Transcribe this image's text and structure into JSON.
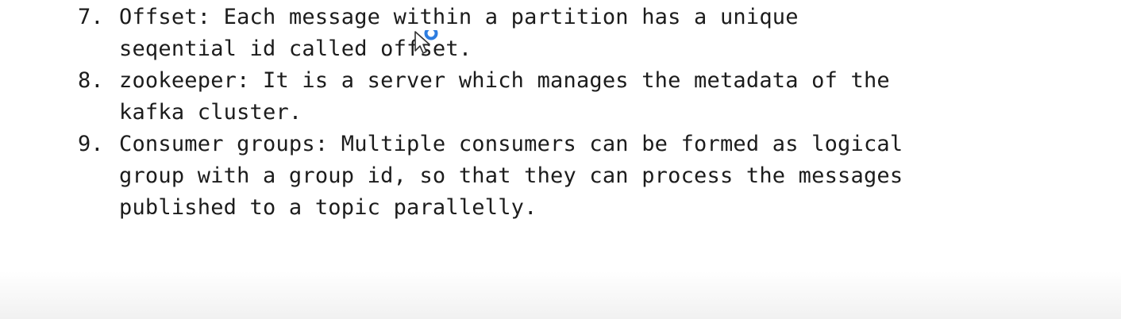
{
  "items": [
    {
      "number": "7.",
      "lines": [
        "Offset: Each message within a partition has a unique",
        "seqential id called offset."
      ]
    },
    {
      "number": "8.",
      "lines": [
        "zookeeper: It is a server which manages the metadata of the",
        "kafka cluster."
      ]
    },
    {
      "number": "9.",
      "lines": [
        "Consumer groups: Multiple consumers can be formed as logical",
        "group with a group id, so that they can process the messages",
        "published to a topic parallelly."
      ]
    }
  ],
  "cursor": {
    "icon": "arrow-pointer-busy-icon",
    "ring_color": "#2d7de0"
  }
}
